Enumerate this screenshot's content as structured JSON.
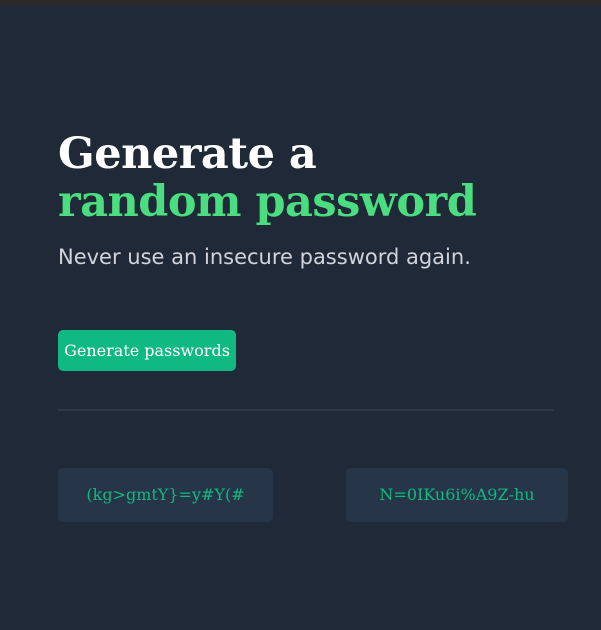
{
  "hero": {
    "title_line1": "Generate a",
    "title_line2": "random password",
    "subtitle": "Never use an insecure password again."
  },
  "actions": {
    "generate_label": "Generate passwords"
  },
  "passwords": [
    "(kg>gmtY}=y#Y(#",
    "N=0IKu6i%A9Z-hu"
  ],
  "colors": {
    "background": "#1f2937",
    "accent_text": "#4ade80",
    "button": "#10b981",
    "password_box": "#273549",
    "password_text": "#10b981",
    "divider": "#2f3a49"
  }
}
